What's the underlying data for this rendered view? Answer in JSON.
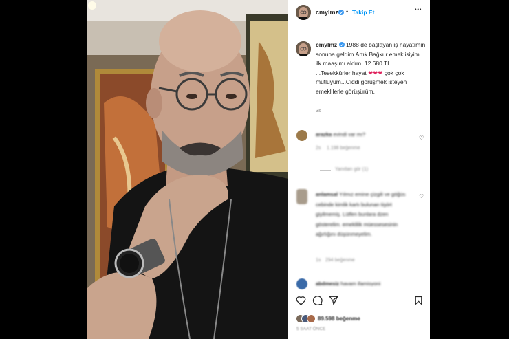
{
  "post_header": {
    "username": "cmylmz",
    "separator": "•",
    "follow_label": "Takip Et",
    "more_label": "•••"
  },
  "caption": {
    "username": "cmylmz",
    "text_1": "1988 de başlayan iş hayatımın sonuna geldim.Artık Bağkur emeklisiyim ilk maaşımı aldım. 12.680 TL ...Tesekkürler hayat ",
    "hearts": "❤❤❤",
    "text_2": " çok çok mutluyum...Ciddi görüşmek isteyen emeklilerle görüşürüm.",
    "time": "3s"
  },
  "comments": [
    {
      "username": "arazka",
      "text": "evindi var mı?",
      "time": "2s",
      "likes": "1.198 beğenme",
      "replies": "Yanıtları gör (1)"
    },
    {
      "username": "anlamsal",
      "text": "Yılmız emine çizgili ve göğüs cebinde kimlik kartı bulunan tişört giyilmemiş. Lütfen bunlara dzen gösterelim. emeklilik müessesesinin ağırlığını düşünmeyelim.",
      "time": "1s",
      "likes": "294 beğenme"
    },
    {
      "username": "abdmesiz",
      "text": "havam ifamisyoni"
    }
  ],
  "footer": {
    "likes": "89.598 beğenme",
    "posted": "5 SAAT ÖNCE"
  },
  "colors": {
    "accent": "#0095f6",
    "heart": "#e0245e",
    "verified": "#3897f0"
  },
  "icons": [
    "verified-badge-icon",
    "more-options-icon",
    "heart-icon",
    "comment-icon",
    "share-icon",
    "save-icon"
  ]
}
